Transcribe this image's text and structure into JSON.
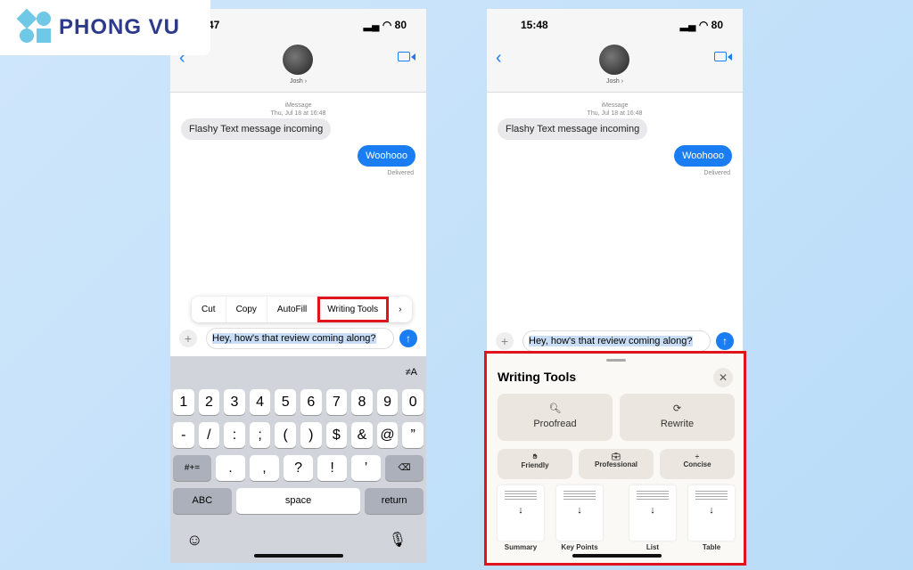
{
  "brand": {
    "name": "PHONG VU",
    "colors": {
      "text": "#2d3a8c",
      "shapes": "#6ec8e6",
      "highlight": "#e0141c",
      "imessage": "#1a7ef2"
    }
  },
  "left": {
    "time": ":47",
    "battery": "80",
    "contact": "Josh ›",
    "service": "iMessage",
    "date": "Thu, Jul 18 at 16:48",
    "incoming": "Flashy Text message incoming",
    "outgoing": "Woohooo",
    "delivered": "Delivered",
    "menu": [
      "Cut",
      "Copy",
      "AutoFill",
      "Writing Tools",
      "›"
    ],
    "input": "Hey, how's that review coming along?",
    "kb_format": "≠A",
    "row1": [
      "1",
      "2",
      "3",
      "4",
      "5",
      "6",
      "7",
      "8",
      "9",
      "0"
    ],
    "row2": [
      "-",
      "/",
      ":",
      ";",
      "(",
      ")",
      "$",
      "&",
      "@",
      "”"
    ],
    "row3": [
      "#+=",
      ".",
      ",",
      "?",
      "!",
      "’",
      "⌫"
    ],
    "abc": "ABC",
    "space": "space",
    "ret": "return"
  },
  "right": {
    "time": "15:48",
    "battery": "80",
    "contact": "Josh ›",
    "service": "iMessage",
    "date": "Thu, Jul 18 at 16:48",
    "incoming": "Flashy Text message incoming",
    "outgoing": "Woohooo",
    "delivered": "Delivered",
    "input": "Hey, how's that review coming along?",
    "panel": {
      "title": "Writing Tools",
      "close": "✕",
      "proofread": "Proofread",
      "rewrite": "Rewrite",
      "friendly": "Friendly",
      "professional": "Professional",
      "concise": "Concise",
      "summary": "Summary",
      "key_points": "Key Points",
      "list": "List",
      "table": "Table"
    }
  }
}
